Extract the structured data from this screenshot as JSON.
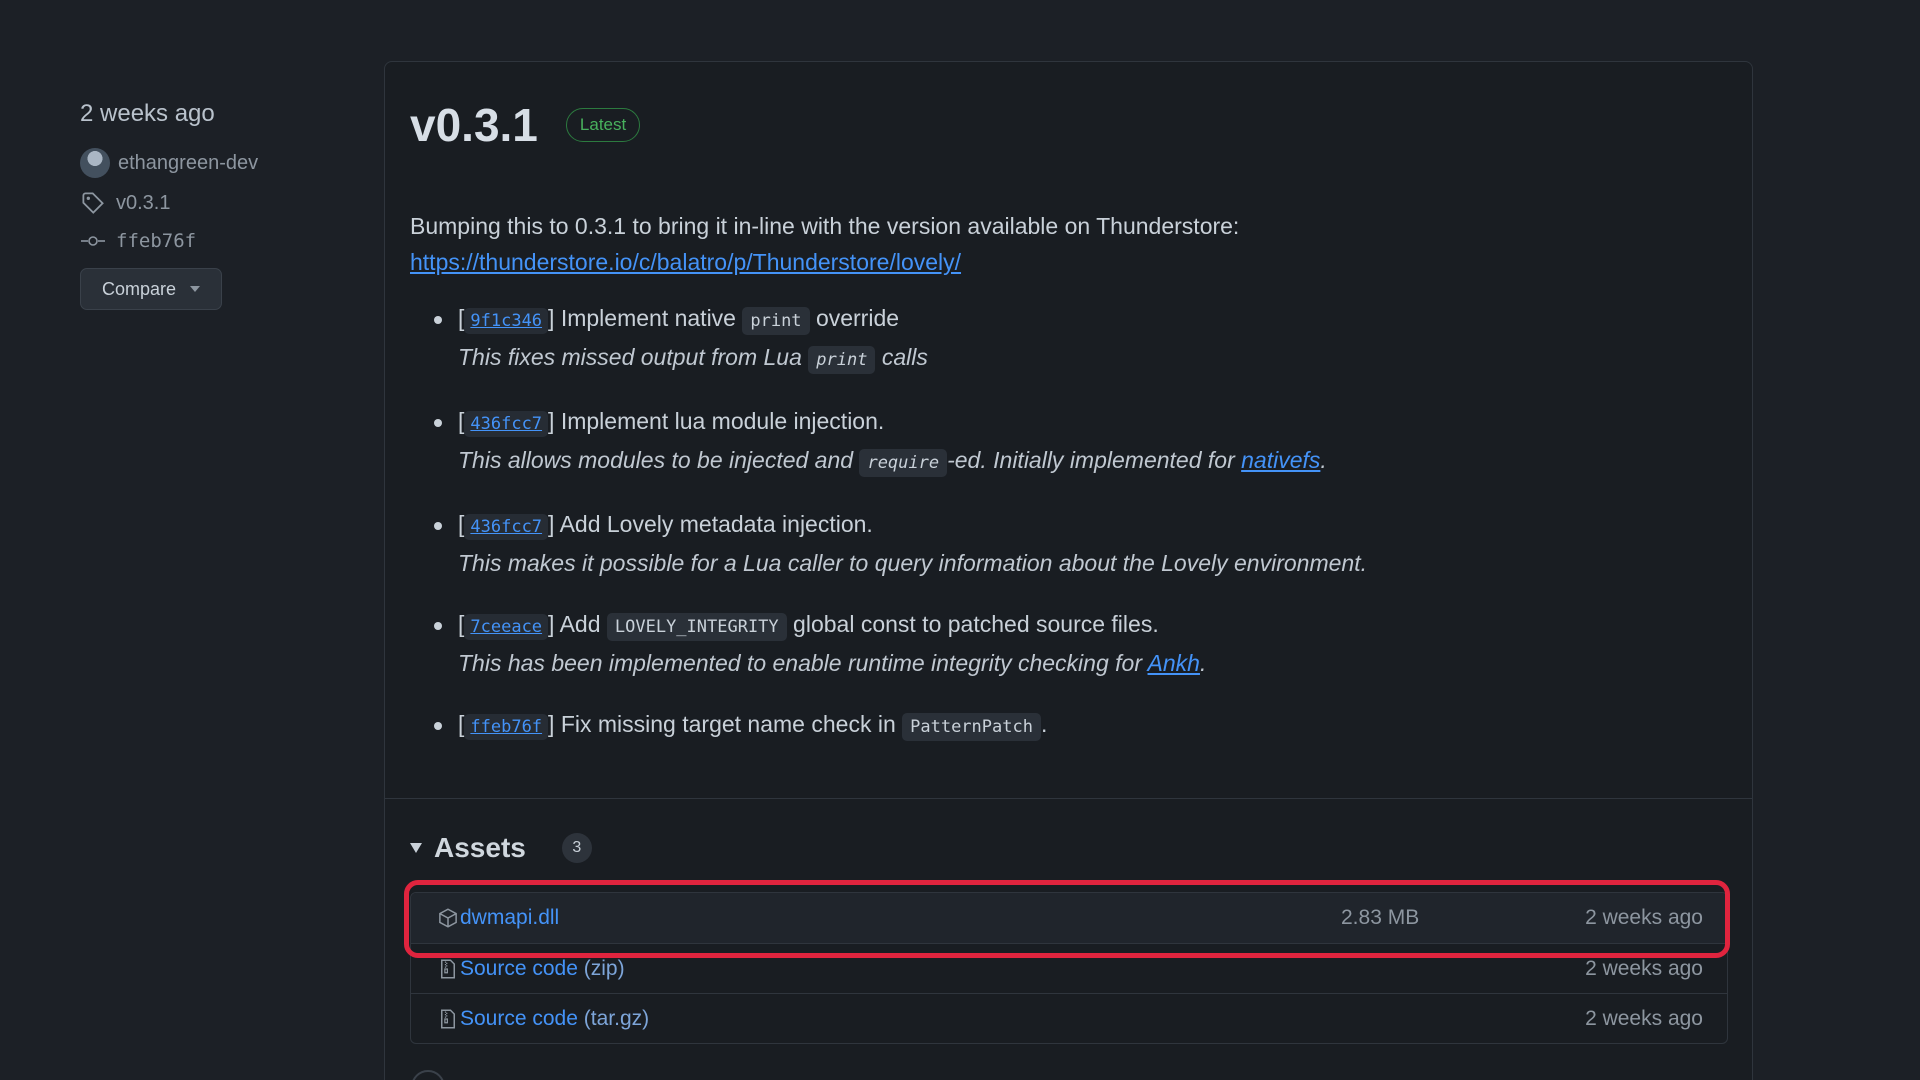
{
  "sidebar": {
    "date": "2 weeks ago",
    "author": "ethangreen-dev",
    "tag": "v0.3.1",
    "commit": "ffeb76f",
    "compare_label": "Compare"
  },
  "release": {
    "title": "v0.3.1",
    "badge": "Latest",
    "intro_text": "Bumping this to 0.3.1 to bring it in-line with the version available on Thunderstore:",
    "intro_link": "https://thunderstore.io/c/balatro/p/Thunderstore/lovely/",
    "changes": [
      {
        "hash": "9f1c346",
        "before": "Implement native",
        "code": "print",
        "after": "override",
        "note_before": "This fixes missed output from Lua",
        "note_code": "print",
        "note_after": "calls"
      },
      {
        "hash": "436fcc7",
        "text": "Implement lua module injection.",
        "note_before": "This allows modules to be injected and",
        "note_code": "require",
        "note_mid": "-ed. Initially implemented for",
        "note_link": "nativefs",
        "note_after": "."
      },
      {
        "hash": "436fcc7",
        "text": "Add Lovely metadata injection.",
        "note": "This makes it possible for a Lua caller to query information about the Lovely environment."
      },
      {
        "hash": "7ceeace",
        "before": "Add",
        "code": "LOVELY_INTEGRITY",
        "after": "global const to patched source files.",
        "note_before": "This has been implemented to enable runtime integrity checking for",
        "note_link": "Ankh",
        "note_after": "."
      },
      {
        "hash": "ffeb76f",
        "before": "Fix missing target name check in",
        "code": "PatternPatch",
        "after": "."
      }
    ]
  },
  "assets": {
    "title": "Assets",
    "count": "3",
    "items": [
      {
        "name": "dwmapi.dll",
        "size": "2.83 MB",
        "date": "2 weeks ago",
        "icon": "package-icon"
      },
      {
        "name": "Source code",
        "suffix": "(zip)",
        "date": "2 weeks ago",
        "icon": "file-zip-icon"
      },
      {
        "name": "Source code",
        "suffix": "(tar.gz)",
        "date": "2 weeks ago",
        "icon": "file-zip-icon"
      }
    ]
  },
  "colors": {
    "background": "#1c2026",
    "link": "#4493f8",
    "latest_badge": "#48b15d",
    "highlight": "#e0243e"
  }
}
